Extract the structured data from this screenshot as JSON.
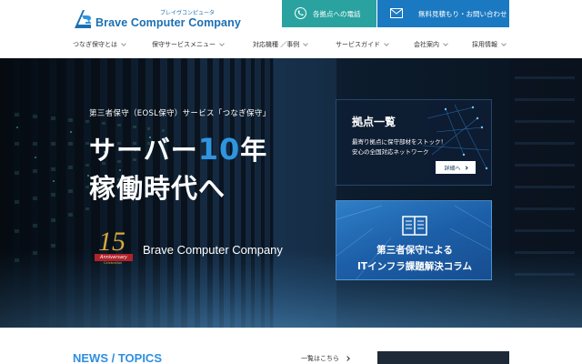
{
  "brand": {
    "kana": "ブレイヴコンピュータ",
    "name": "Brave Computer Company"
  },
  "cta": {
    "phone_label": "各拠点への電話",
    "mail_label": "無料見積もり・お問い合わせ"
  },
  "nav": {
    "items": [
      {
        "label": "つなぎ保守とは"
      },
      {
        "label": "保守サービスメニュー"
      },
      {
        "label": "対応機種 ／事例"
      },
      {
        "label": "サービスガイド"
      },
      {
        "label": "会社案内"
      },
      {
        "label": "採用情報"
      }
    ]
  },
  "hero": {
    "subtitle": "第三者保守（EOSL保守）サービス「つなぎ保守」",
    "title_prefix": "サーバー",
    "title_number": "10",
    "title_suffix": "年",
    "title_line2": "稼働時代へ",
    "anniversary_number": "15",
    "anniversary_ribbon": "Anniversary",
    "anniversary_sub": "Celebration",
    "company_name": "Brave Computer Company"
  },
  "cards": {
    "locations": {
      "title": "拠点一覧",
      "line1": "最寄り拠点に保守部材をストック！",
      "line2": "安心の全国対応ネットワーク",
      "button": "詳細へ"
    },
    "column": {
      "line1": "第三者保守による",
      "line2": "ITインフラ課題解決コラム"
    }
  },
  "news": {
    "title": "NEWS / TOPICS",
    "more_link": "一覧はこちら"
  },
  "colors": {
    "brand_blue": "#1b6fb3",
    "phone_teal": "#2aa3a0",
    "mail_blue": "#1b79c2",
    "accent_blue": "#2f95e0",
    "news_blue": "#2f8fe0"
  }
}
